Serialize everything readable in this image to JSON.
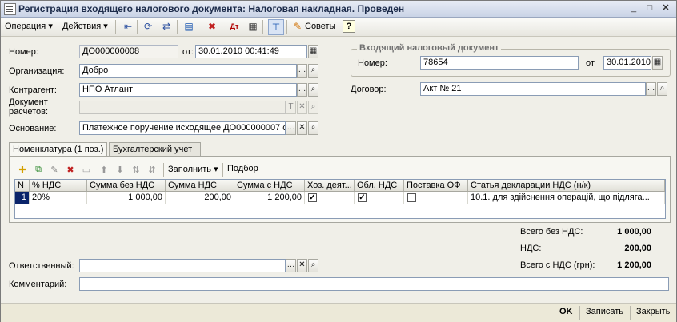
{
  "window": {
    "title": "Регистрация входящего налогового документа: Налоговая накладная. Проведен"
  },
  "toolbar": {
    "operation": "Операция",
    "actions": "Действия",
    "tips": "Советы",
    "help": "?"
  },
  "form": {
    "number_label": "Номер:",
    "number_value": "ДО000000008",
    "date_from_label": "от:",
    "date_value": "30.01.2010 00:41:49",
    "org_label": "Организация:",
    "org_value": "Добро",
    "contractor_label": "Контрагент:",
    "contractor_value": "НПО Атлант",
    "settle_doc_label": "Документ расчетов:",
    "settle_doc_value": "",
    "basis_label": "Основание:",
    "basis_value": "Платежное поручение исходящее ДО000000007 с",
    "incoming_group_title": "Входящий налоговый документ",
    "in_number_label": "Номер:",
    "in_number_value": "78654",
    "in_date_label": "от",
    "in_date_value": "30.01.2010",
    "contract_label": "Договор:",
    "contract_value": "Акт № 21",
    "responsible_label": "Ответственный:",
    "responsible_value": "",
    "comment_label": "Комментарий:",
    "comment_value": ""
  },
  "tabs": [
    {
      "label": "Номенклатура (1 поз.)"
    },
    {
      "label": "Бухгалтерский учет"
    }
  ],
  "grid_toolbar": {
    "fill": "Заполнить",
    "pick": "Подбор"
  },
  "table": {
    "headers": [
      "N",
      "% НДС",
      "Сумма без НДС",
      "Сумма НДС",
      "Сумма с НДС",
      "Хоз. деят...",
      "Обл. НДС",
      "Поставка ОФ",
      "Статья декларации НДС (н/к)"
    ],
    "rows": [
      {
        "n": "1",
        "vat_rate": "20%",
        "sum_no_vat": "1 000,00",
        "vat_sum": "200,00",
        "sum_with_vat": "1 200,00",
        "econ_activity": true,
        "vat_taxed": true,
        "fixed_asset": false,
        "decl_article": "10.1. для здійснення операцій, що підляга..."
      }
    ]
  },
  "totals": {
    "no_vat_label": "Всего без НДС:",
    "no_vat_value": "1 000,00",
    "vat_label": "НДС:",
    "vat_value": "200,00",
    "with_vat_label": "Всего с НДС (грн):",
    "with_vat_value": "1 200,00"
  },
  "bottom": {
    "ok": "OK",
    "save": "Записать",
    "close": "Закрыть"
  }
}
